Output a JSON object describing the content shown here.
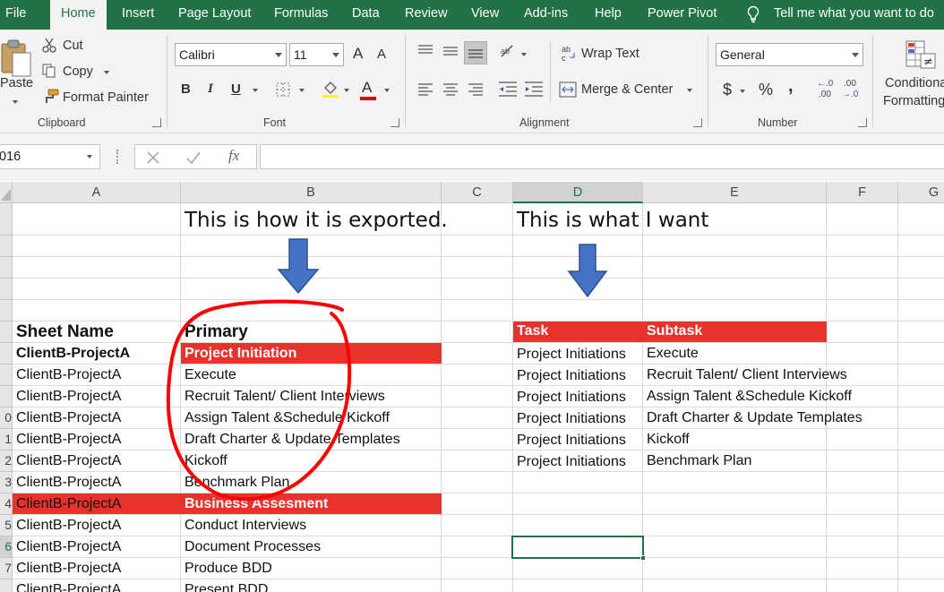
{
  "tabs": [
    {
      "label": "File"
    },
    {
      "label": "Home"
    },
    {
      "label": "Insert"
    },
    {
      "label": "Page Layout"
    },
    {
      "label": "Formulas"
    },
    {
      "label": "Data"
    },
    {
      "label": "Review"
    },
    {
      "label": "View"
    },
    {
      "label": "Add-ins"
    },
    {
      "label": "Help"
    },
    {
      "label": "Power Pivot"
    }
  ],
  "tell_me": "Tell me what you want to do",
  "clipboard": {
    "paste": "Paste",
    "cut": "Cut",
    "copy": "Copy",
    "format_painter": "Format Painter",
    "label": "Clipboard"
  },
  "font": {
    "name": "Calibri",
    "size": "11",
    "bold": "B",
    "italic": "I",
    "underline": "U",
    "grow": "A",
    "shrink": "A",
    "color_letter": "A",
    "label": "Font"
  },
  "alignment": {
    "wrap_text": "Wrap Text",
    "merge_center": "Merge & Center",
    "label": "Alignment"
  },
  "number": {
    "format": "General",
    "currency": "$",
    "percent": "%",
    "comma": ",",
    "inc_decimal_a": "←.0",
    "inc_decimal_b": ".00",
    "dec_decimal_a": ".00",
    "dec_decimal_b": "→.0",
    "label": "Number"
  },
  "styles": {
    "conditional_1": "Conditional",
    "conditional_2": "Formatting"
  },
  "formula_bar": {
    "name_box": "016",
    "fx": "fx",
    "value": ""
  },
  "columns": [
    "A",
    "B",
    "C",
    "D",
    "E",
    "F",
    "G"
  ],
  "rows": [
    "",
    "",
    "",
    "",
    "",
    "",
    "",
    "",
    "",
    "0",
    "1",
    "2",
    "3",
    "4",
    "5",
    "6",
    "7",
    ""
  ],
  "sheet": {
    "heading_left": "This is how it is exported.",
    "heading_right": "This is what I want",
    "header_sheet_name": "Sheet Name",
    "header_primary": "Primary",
    "a_cells": [
      "ClientB-ProjectA",
      "ClientB-ProjectA",
      "ClientB-ProjectA",
      "ClientB-ProjectA",
      "ClientB-ProjectA",
      "ClientB-ProjectA",
      "ClientB-ProjectA",
      "ClientB-ProjectA",
      "ClientB-ProjectA",
      "ClientB-ProjectA",
      "ClientB-ProjectA",
      "ClientB-ProjectA"
    ],
    "b_cells": [
      "Project Initiation",
      "Execute",
      "Recruit Talent/ Client Interviews",
      "Assign Talent &Schedule Kickoff",
      "Draft Charter & Update Templates",
      "Kickoff",
      "Benchmark Plan",
      "Business Assesment",
      "Conduct Interviews",
      "Document Processes",
      "Produce BDD",
      "Present BDD"
    ],
    "task_header": "Task",
    "subtask_header": "Subtask",
    "d_cells": [
      "Project Initiations",
      "Project Initiations",
      "Project Initiations",
      "Project Initiations",
      "Project Initiations",
      "Project Initiations"
    ],
    "e_cells": [
      "Execute",
      "Recruit Talent/ Client Interviews",
      "Assign Talent &Schedule Kickoff",
      "Draft Charter & Update Templates",
      "Kickoff",
      "Benchmark Plan"
    ]
  },
  "colors": {
    "excel_green": "#217346",
    "highlight_red": "#e8322e",
    "arrow_blue": "#4472c4",
    "annotation_red": "#ff0000"
  }
}
